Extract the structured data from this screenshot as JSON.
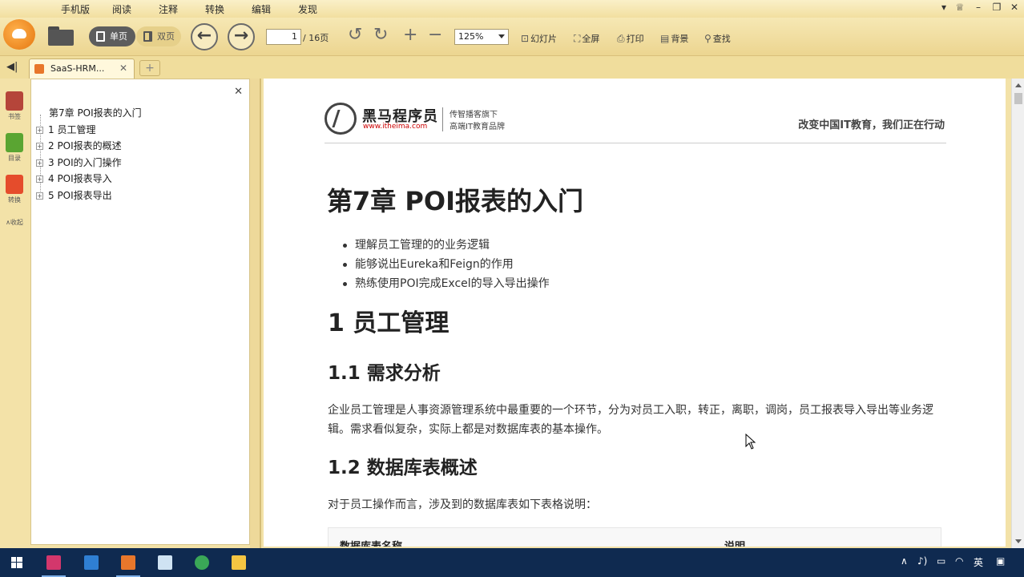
{
  "menu": [
    "手机版",
    "阅读",
    "注释",
    "转换",
    "编辑",
    "发现"
  ],
  "toolbar": {
    "view_single": "单页",
    "view_double": "双页",
    "page_current": "1",
    "page_total": "/ 16页",
    "zoom": "125%",
    "tools": [
      "幻灯片",
      "全屏",
      "打印",
      "背景",
      "查找"
    ]
  },
  "tab": {
    "title": "SaaS-HRM..."
  },
  "sidebar": {
    "items": [
      "书签",
      "目录",
      "转换"
    ],
    "collapse": "收起"
  },
  "outline": {
    "root": "第7章 POI报表的入门",
    "items": [
      "1 员工管理",
      "2 POI报表的概述",
      "3 POI的入门操作",
      "4 POI报表导入",
      "5 POI报表导出"
    ]
  },
  "document": {
    "brand_name": "黑马程序员",
    "brand_url": "www.itheima.com",
    "brand_sub1": "传智播客旗下",
    "brand_sub2": "高端IT教育品牌",
    "slogan": "改变中国IT教育，我们正在行动",
    "chapter_title": "第7章 POI报表的入门",
    "bullets": [
      "理解员工管理的的业务逻辑",
      "能够说出Eureka和Feign的作用",
      "熟练使用POI完成Excel的导入导出操作"
    ],
    "h2": "1 员工管理",
    "h3_1": "1.1 需求分析",
    "para_1": "企业员工管理是人事资源管理系统中最重要的一个环节，分为对员工入职，转正，离职，调岗，员工报表导入导出等业务逻辑。需求看似复杂，实际上都是对数据库表的基本操作。",
    "h3_2": "1.2 数据库表概述",
    "para_2": "对于员工操作而言，涉及到的数据库表如下表格说明：",
    "table_headers": [
      "数据库表名称",
      "说明"
    ]
  },
  "taskbar": {
    "ime": "英"
  },
  "colors": {
    "toolbar_bg": "#f3e2a8",
    "taskbar_bg": "#0f2a50",
    "accent": "#e8772b"
  }
}
